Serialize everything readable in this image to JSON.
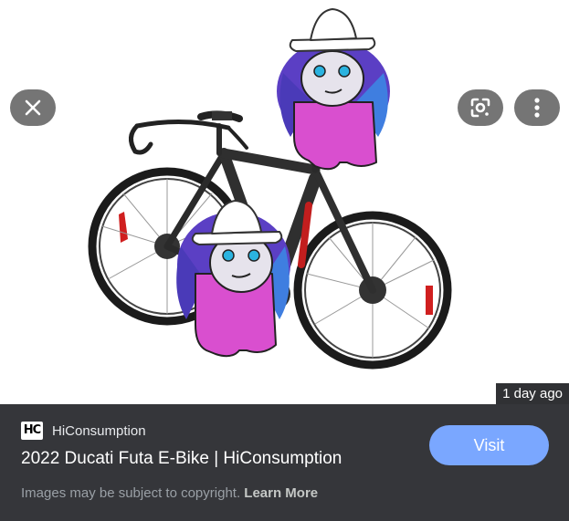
{
  "controls": {
    "close_icon": "close-icon",
    "lens_icon": "google-lens-icon",
    "more_icon": "more-vertical-icon"
  },
  "image": {
    "time_badge": "1 day ago"
  },
  "result": {
    "logo_text": "HC",
    "source": "HiConsumption",
    "title": "2022 Ducati Futa E-Bike | HiConsumption",
    "visit_label": "Visit",
    "copyright_text": "Images may be subject to copyright.",
    "learn_more_label": "Learn More"
  },
  "colors": {
    "panel": "#35363a",
    "visit_button": "#7aa7ff",
    "control_button": "#757575"
  }
}
